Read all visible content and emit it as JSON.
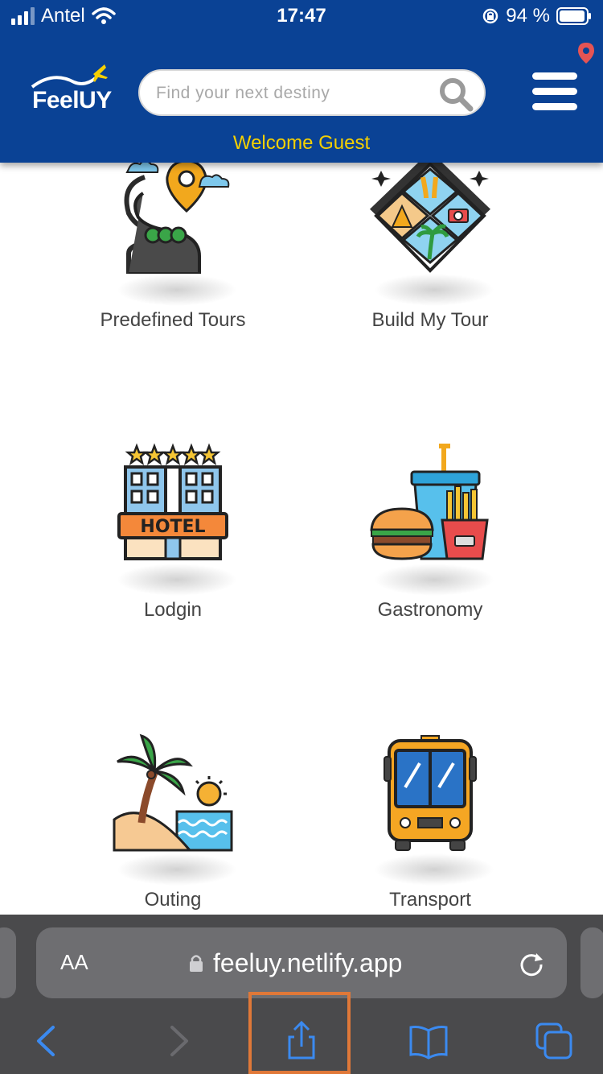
{
  "status_bar": {
    "carrier": "Antel",
    "time": "17:47",
    "battery": "94 %"
  },
  "header": {
    "logo_text": "FeelUY",
    "search_placeholder": "Find your next destiny",
    "welcome": "Welcome Guest"
  },
  "tiles": [
    {
      "label": "Predefined Tours",
      "icon": "road-map-pin-icon"
    },
    {
      "label": "Build My Tour",
      "icon": "travel-collage-icon"
    },
    {
      "label": "Lodgin",
      "icon": "hotel-icon"
    },
    {
      "label": "Gastronomy",
      "icon": "fast-food-icon"
    },
    {
      "label": "Outing",
      "icon": "beach-island-icon"
    },
    {
      "label": "Transport",
      "icon": "bus-icon"
    }
  ],
  "browser": {
    "text_size_label": "AA",
    "url": "feeluy.netlify.app"
  },
  "colors": {
    "header_blue": "#0a4295",
    "welcome_yellow": "#f5d000",
    "safari_blue": "#3b8af0",
    "highlight": "#e07838"
  }
}
